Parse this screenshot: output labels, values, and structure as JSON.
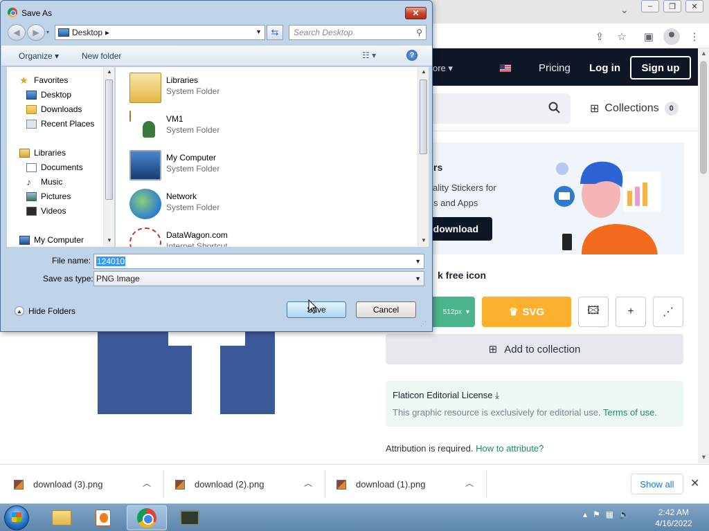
{
  "browser": {
    "win_controls": [
      "–",
      "❐",
      "✕"
    ],
    "nav": {
      "more_label": "ore ▾",
      "pricing": "Pricing",
      "login": "Log in",
      "signup": "Sign up"
    },
    "collections": {
      "label": "Collections",
      "count": "0"
    },
    "banner": {
      "title": "rs",
      "line1": "ality Stickers for",
      "line2": "s and Apps",
      "button": "download"
    },
    "free_icon": "k free icon",
    "png_size": "512px",
    "svg_label": "SVG",
    "add_collection": "Add to collection",
    "license": {
      "title": "Flaticon Editorial License",
      "text": "This graphic resource is exclusively for editorial use.",
      "link": "Terms of use."
    },
    "attribution": {
      "text": "Attribution is required.",
      "link": "How to attribute?"
    }
  },
  "downloads": {
    "items": [
      {
        "name": "download (3).png"
      },
      {
        "name": "download (2).png"
      },
      {
        "name": "download (1).png"
      }
    ],
    "show_all": "Show all"
  },
  "taskbar": {
    "clock_time": "2:42 AM",
    "clock_date": "4/16/2022"
  },
  "dialog": {
    "title": "Save As",
    "close_symbol": "✕",
    "address": "Desktop",
    "search_placeholder": "Search Desktop",
    "toolbar": {
      "organize": "Organize ▾",
      "new_folder": "New folder",
      "help": "?"
    },
    "nav_pane": {
      "favorites": "Favorites",
      "desktop": "Desktop",
      "downloads": "Downloads",
      "recent": "Recent Places",
      "libraries": "Libraries",
      "documents": "Documents",
      "music": "Music",
      "pictures": "Pictures",
      "videos": "Videos",
      "my_computer": "My Computer"
    },
    "files": [
      {
        "name": "Libraries",
        "type": "System Folder"
      },
      {
        "name": "VM1",
        "type": "System Folder"
      },
      {
        "name": "My Computer",
        "type": "System Folder"
      },
      {
        "name": "Network",
        "type": "System Folder"
      },
      {
        "name": "DataWagon.com",
        "type": "Internet Shortcut"
      }
    ],
    "file_name_label": "File name:",
    "file_name_value": "124010",
    "save_type_label": "Save as type:",
    "save_type_value": "PNG Image",
    "hide_folders": "Hide Folders",
    "save_button": "Save",
    "cancel_button": "Cancel"
  }
}
